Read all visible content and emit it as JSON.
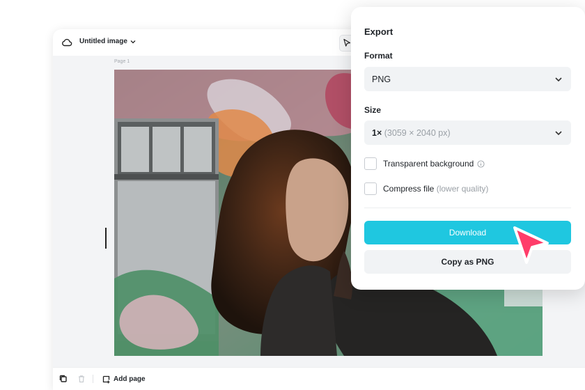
{
  "editor": {
    "doc_title": "Untitled image",
    "page_label": "Page 1",
    "add_page_label": "Add page"
  },
  "export_panel": {
    "title": "Export",
    "format_label": "Format",
    "format_value": "PNG",
    "size_label": "Size",
    "size_value": "1×",
    "size_dims": "(3059 × 2040 px)",
    "transparent_label": "Transparent background",
    "transparent_checked": false,
    "compress_label": "Compress file",
    "compress_note": "(lower quality)",
    "compress_checked": false,
    "download_label": "Download",
    "copy_label": "Copy as PNG"
  },
  "colors": {
    "accent": "#1fc7e0",
    "cursor": "#ff3d6a"
  },
  "icons": {
    "cloud": "cloud-icon",
    "select_tool": "pointer-icon",
    "format_chevron": "chevron-down-icon",
    "info": "info-icon",
    "copy": "duplicate-icon",
    "trash": "trash-icon",
    "add": "add-page-icon"
  }
}
